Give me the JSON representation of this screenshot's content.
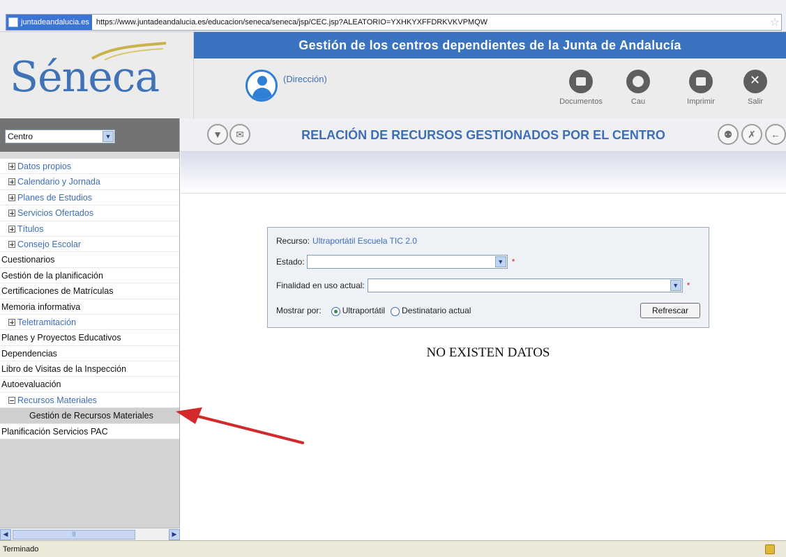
{
  "browser": {
    "site_chip": "juntadeandalucia.es",
    "url": "https://www.juntadeandalucia.es/educacion/seneca/seneca/jsp/CEC.jsp?ALEATORIO=YXHKYXFFDRKVKVPMQW"
  },
  "header": {
    "logo": "Séneca",
    "banner": "Gestión de los centros dependientes de la Junta de Andalucía",
    "role": "(Dirección)",
    "tools": [
      {
        "label": "Documentos",
        "icon": "book-icon"
      },
      {
        "label": "Cau",
        "icon": "headset-icon"
      },
      {
        "label": "Imprimir",
        "icon": "printer-icon"
      },
      {
        "label": "Salir",
        "icon": "close-icon"
      }
    ]
  },
  "sidebar": {
    "selector": "Centro",
    "items": [
      {
        "label": "Datos propios",
        "type": "collapsed"
      },
      {
        "label": "Calendario y Jornada",
        "type": "collapsed"
      },
      {
        "label": "Planes de Estudios",
        "type": "collapsed"
      },
      {
        "label": "Servicios Ofertados",
        "type": "collapsed"
      },
      {
        "label": "Títulos",
        "type": "collapsed"
      },
      {
        "label": "Consejo Escolar",
        "type": "collapsed"
      },
      {
        "label": "Cuestionarios",
        "type": "leaf"
      },
      {
        "label": "Gestión de la planificación",
        "type": "leaf"
      },
      {
        "label": "Certificaciones de Matrículas",
        "type": "leaf"
      },
      {
        "label": "Memoria informativa",
        "type": "leaf"
      },
      {
        "label": "Teletramitación",
        "type": "collapsed"
      },
      {
        "label": "Planes y Proyectos Educativos",
        "type": "leaf"
      },
      {
        "label": "Dependencias",
        "type": "leaf"
      },
      {
        "label": "Libro de Visitas de la Inspección",
        "type": "leaf"
      },
      {
        "label": "Autoevaluación",
        "type": "leaf"
      },
      {
        "label": "Recursos Materiales",
        "type": "expanded"
      },
      {
        "label": "Gestión de Recursos Materiales",
        "type": "child"
      },
      {
        "label": "Planificación Servicios PAC",
        "type": "leaf"
      }
    ]
  },
  "main": {
    "title": "RELACIÓN DE RECURSOS GESTIONADOS POR EL CENTRO",
    "form": {
      "recurso_label": "Recurso:",
      "recurso_value": "Ultraportátil Escuela TIC 2.0",
      "estado_label": "Estado:",
      "estado_value": "",
      "finalidad_label": "Finalidad en uso actual:",
      "finalidad_value": "",
      "required_mark": "*",
      "mostrar_label": "Mostrar por:",
      "option_1": "Ultraportátil",
      "option_2": "Destinatario actual",
      "selected_option": "Ultraportátil",
      "refresh_label": "Refrescar"
    },
    "empty_message": "NO EXISTEN DATOS"
  },
  "status": {
    "text": "Terminado"
  },
  "colors": {
    "brand_blue": "#3a74c0",
    "link_blue": "#3e6fb6",
    "annotation_red": "#d22a2a"
  }
}
